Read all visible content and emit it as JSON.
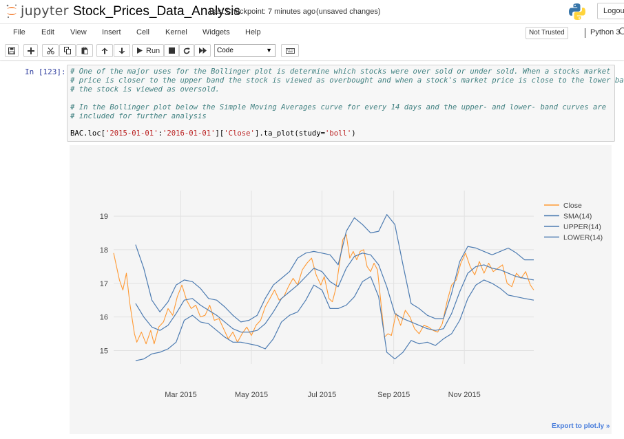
{
  "header": {
    "logo_text": "jupyter",
    "notebook_title": "Stock_Prices_Data_Analysis",
    "checkpoint": "Last Checkpoint: 7 minutes ago",
    "save_status": "(unsaved changes)",
    "logout_label": "Logout"
  },
  "menubar": {
    "items": [
      "File",
      "Edit",
      "View",
      "Insert",
      "Cell",
      "Kernel",
      "Widgets",
      "Help"
    ],
    "trust_label": "Not Trusted",
    "kernel_name": "Python 3"
  },
  "toolbar": {
    "run_label": "Run",
    "cell_type": "Code",
    "icons": [
      "save-icon",
      "plus-icon",
      "cut-icon",
      "copy-icon",
      "paste-icon",
      "arrow-up-icon",
      "arrow-down-icon",
      "run-icon",
      "stop-icon",
      "restart-icon",
      "fast-forward-icon",
      "keyboard-icon"
    ]
  },
  "cell": {
    "prompt": "In [123]:",
    "comment_lines": [
      "# One of the major uses for the Bollinger plot is determine which stocks were over sold or under sold. When a stocks market",
      "# price is closer to the upper band the stock is viewed as overbought and when a stock's market price is close to the lower band",
      "# the stock is viewed as oversold.",
      "",
      "# In the Bollinger plot below the Simple Moving Averages curve for every 14 days and the upper- and lower- band curves are",
      "# included for further analysis"
    ],
    "code": {
      "prefix": "BAC.loc[",
      "arg1": "'2015-01-01'",
      "colon": ":",
      "arg2": "'2016-01-01'",
      "mid": "][",
      "arg3": "'Close'",
      "call": "].ta_plot(study=",
      "arg4": "'boll'",
      "suffix": ")"
    }
  },
  "output": {
    "export_label": "Export to plot.ly »"
  },
  "chart_data": {
    "type": "line",
    "title": "",
    "xlabel": "",
    "ylabel": "",
    "x_tick_labels": [
      "Mar 2015",
      "May 2015",
      "Jul 2015",
      "Sep 2015",
      "Nov 2015"
    ],
    "x_tick_dates": [
      "2015-03-01",
      "2015-05-01",
      "2015-07-01",
      "2015-09-01",
      "2015-11-01"
    ],
    "xlim": [
      "2015-01-02",
      "2015-12-31"
    ],
    "y_ticks": [
      15,
      16,
      17,
      18,
      19
    ],
    "ylim": [
      14.6,
      19.35
    ],
    "grid": true,
    "legend_position": "top-right",
    "series": [
      {
        "name": "Close",
        "color": "#ff9933",
        "points": [
          [
            "2015-01-02",
            17.9
          ],
          [
            "2015-01-07",
            17.1
          ],
          [
            "2015-01-10",
            16.8
          ],
          [
            "2015-01-13",
            17.3
          ],
          [
            "2015-01-16",
            16.4
          ],
          [
            "2015-01-20",
            15.5
          ],
          [
            "2015-01-22",
            15.25
          ],
          [
            "2015-01-26",
            15.55
          ],
          [
            "2015-01-30",
            15.2
          ],
          [
            "2015-02-03",
            15.6
          ],
          [
            "2015-02-06",
            15.2
          ],
          [
            "2015-02-10",
            15.7
          ],
          [
            "2015-02-14",
            15.85
          ],
          [
            "2015-02-18",
            16.25
          ],
          [
            "2015-02-22",
            16.05
          ],
          [
            "2015-02-26",
            16.6
          ],
          [
            "2015-03-02",
            16.95
          ],
          [
            "2015-03-06",
            16.5
          ],
          [
            "2015-03-10",
            16.25
          ],
          [
            "2015-03-14",
            16.35
          ],
          [
            "2015-03-18",
            16.0
          ],
          [
            "2015-03-22",
            16.05
          ],
          [
            "2015-03-26",
            16.35
          ],
          [
            "2015-03-30",
            15.9
          ],
          [
            "2015-04-03",
            15.95
          ],
          [
            "2015-04-07",
            15.65
          ],
          [
            "2015-04-11",
            15.35
          ],
          [
            "2015-04-15",
            15.55
          ],
          [
            "2015-04-19",
            15.25
          ],
          [
            "2015-04-23",
            15.5
          ],
          [
            "2015-04-27",
            15.7
          ],
          [
            "2015-05-01",
            15.45
          ],
          [
            "2015-05-05",
            15.75
          ],
          [
            "2015-05-09",
            15.9
          ],
          [
            "2015-05-13",
            16.3
          ],
          [
            "2015-05-17",
            16.55
          ],
          [
            "2015-05-21",
            16.8
          ],
          [
            "2015-05-25",
            16.5
          ],
          [
            "2015-05-29",
            16.6
          ],
          [
            "2015-06-02",
            16.9
          ],
          [
            "2015-06-06",
            17.15
          ],
          [
            "2015-06-10",
            16.95
          ],
          [
            "2015-06-14",
            17.4
          ],
          [
            "2015-06-18",
            17.6
          ],
          [
            "2015-06-22",
            17.75
          ],
          [
            "2015-06-26",
            17.25
          ],
          [
            "2015-06-30",
            16.95
          ],
          [
            "2015-07-03",
            17.2
          ],
          [
            "2015-07-07",
            16.55
          ],
          [
            "2015-07-10",
            16.45
          ],
          [
            "2015-07-13",
            16.85
          ],
          [
            "2015-07-16",
            17.55
          ],
          [
            "2015-07-19",
            18.3
          ],
          [
            "2015-07-22",
            18.45
          ],
          [
            "2015-07-25",
            17.75
          ],
          [
            "2015-07-28",
            17.95
          ],
          [
            "2015-07-31",
            17.7
          ],
          [
            "2015-08-03",
            17.95
          ],
          [
            "2015-08-06",
            18.0
          ],
          [
            "2015-08-09",
            17.5
          ],
          [
            "2015-08-12",
            17.35
          ],
          [
            "2015-08-15",
            17.6
          ],
          [
            "2015-08-18",
            17.4
          ],
          [
            "2015-08-21",
            16.4
          ],
          [
            "2015-08-24",
            15.4
          ],
          [
            "2015-08-27",
            15.5
          ],
          [
            "2015-08-30",
            15.45
          ],
          [
            "2015-09-03",
            16.1
          ],
          [
            "2015-09-07",
            15.75
          ],
          [
            "2015-09-11",
            16.2
          ],
          [
            "2015-09-15",
            16.0
          ],
          [
            "2015-09-19",
            15.65
          ],
          [
            "2015-09-23",
            15.5
          ],
          [
            "2015-09-27",
            15.75
          ],
          [
            "2015-10-01",
            15.7
          ],
          [
            "2015-10-05",
            15.6
          ],
          [
            "2015-10-09",
            15.55
          ],
          [
            "2015-10-13",
            15.8
          ],
          [
            "2015-10-17",
            16.45
          ],
          [
            "2015-10-21",
            16.95
          ],
          [
            "2015-10-25",
            17.1
          ],
          [
            "2015-10-29",
            17.6
          ],
          [
            "2015-11-02",
            17.9
          ],
          [
            "2015-11-06",
            17.5
          ],
          [
            "2015-11-10",
            17.25
          ],
          [
            "2015-11-14",
            17.65
          ],
          [
            "2015-11-18",
            17.3
          ],
          [
            "2015-11-22",
            17.6
          ],
          [
            "2015-11-26",
            17.35
          ],
          [
            "2015-11-30",
            17.45
          ],
          [
            "2015-12-04",
            17.55
          ],
          [
            "2015-12-08",
            17.0
          ],
          [
            "2015-12-12",
            16.9
          ],
          [
            "2015-12-16",
            17.3
          ],
          [
            "2015-12-20",
            17.15
          ],
          [
            "2015-12-24",
            17.35
          ],
          [
            "2015-12-28",
            16.95
          ],
          [
            "2015-12-31",
            16.8
          ]
        ]
      },
      {
        "name": "SMA(14)",
        "color": "#4c7bb1",
        "points": [
          [
            "2015-01-21",
            16.4
          ],
          [
            "2015-01-28",
            16.0
          ],
          [
            "2015-02-04",
            15.7
          ],
          [
            "2015-02-11",
            15.6
          ],
          [
            "2015-02-18",
            15.75
          ],
          [
            "2015-02-25",
            16.1
          ],
          [
            "2015-03-04",
            16.5
          ],
          [
            "2015-03-11",
            16.55
          ],
          [
            "2015-03-18",
            16.35
          ],
          [
            "2015-03-25",
            16.2
          ],
          [
            "2015-04-01",
            16.05
          ],
          [
            "2015-04-08",
            15.85
          ],
          [
            "2015-04-15",
            15.65
          ],
          [
            "2015-04-22",
            15.55
          ],
          [
            "2015-04-29",
            15.55
          ],
          [
            "2015-05-06",
            15.6
          ],
          [
            "2015-05-13",
            15.8
          ],
          [
            "2015-05-20",
            16.15
          ],
          [
            "2015-05-27",
            16.55
          ],
          [
            "2015-06-03",
            16.75
          ],
          [
            "2015-06-10",
            16.95
          ],
          [
            "2015-06-17",
            17.2
          ],
          [
            "2015-06-24",
            17.45
          ],
          [
            "2015-07-01",
            17.35
          ],
          [
            "2015-07-08",
            17.05
          ],
          [
            "2015-07-15",
            16.9
          ],
          [
            "2015-07-22",
            17.45
          ],
          [
            "2015-07-29",
            17.8
          ],
          [
            "2015-08-05",
            17.9
          ],
          [
            "2015-08-12",
            17.85
          ],
          [
            "2015-08-19",
            17.55
          ],
          [
            "2015-08-26",
            16.9
          ],
          [
            "2015-09-02",
            16.1
          ],
          [
            "2015-09-09",
            15.95
          ],
          [
            "2015-09-16",
            15.85
          ],
          [
            "2015-09-23",
            15.75
          ],
          [
            "2015-09-30",
            15.65
          ],
          [
            "2015-10-07",
            15.6
          ],
          [
            "2015-10-14",
            15.65
          ],
          [
            "2015-10-21",
            16.1
          ],
          [
            "2015-10-28",
            16.75
          ],
          [
            "2015-11-04",
            17.3
          ],
          [
            "2015-11-11",
            17.5
          ],
          [
            "2015-11-18",
            17.55
          ],
          [
            "2015-11-25",
            17.45
          ],
          [
            "2015-12-02",
            17.4
          ],
          [
            "2015-12-09",
            17.3
          ],
          [
            "2015-12-16",
            17.2
          ],
          [
            "2015-12-23",
            17.15
          ],
          [
            "2015-12-31",
            17.1
          ]
        ]
      },
      {
        "name": "UPPER(14)",
        "color": "#4c7bb1",
        "points": [
          [
            "2015-01-21",
            18.15
          ],
          [
            "2015-01-28",
            17.45
          ],
          [
            "2015-02-04",
            16.5
          ],
          [
            "2015-02-11",
            16.15
          ],
          [
            "2015-02-18",
            16.45
          ],
          [
            "2015-02-25",
            16.95
          ],
          [
            "2015-03-04",
            17.1
          ],
          [
            "2015-03-11",
            17.05
          ],
          [
            "2015-03-18",
            16.85
          ],
          [
            "2015-03-25",
            16.55
          ],
          [
            "2015-04-01",
            16.5
          ],
          [
            "2015-04-08",
            16.3
          ],
          [
            "2015-04-15",
            16.05
          ],
          [
            "2015-04-22",
            15.85
          ],
          [
            "2015-04-29",
            15.9
          ],
          [
            "2015-05-06",
            16.05
          ],
          [
            "2015-05-13",
            16.55
          ],
          [
            "2015-05-20",
            16.95
          ],
          [
            "2015-05-27",
            17.15
          ],
          [
            "2015-06-03",
            17.35
          ],
          [
            "2015-06-10",
            17.75
          ],
          [
            "2015-06-17",
            17.9
          ],
          [
            "2015-06-24",
            17.95
          ],
          [
            "2015-07-01",
            17.9
          ],
          [
            "2015-07-08",
            17.85
          ],
          [
            "2015-07-15",
            17.55
          ],
          [
            "2015-07-22",
            18.55
          ],
          [
            "2015-07-29",
            18.95
          ],
          [
            "2015-08-05",
            18.75
          ],
          [
            "2015-08-12",
            18.5
          ],
          [
            "2015-08-19",
            18.55
          ],
          [
            "2015-08-26",
            19.05
          ],
          [
            "2015-09-02",
            18.75
          ],
          [
            "2015-09-09",
            17.55
          ],
          [
            "2015-09-16",
            16.4
          ],
          [
            "2015-09-23",
            16.25
          ],
          [
            "2015-09-30",
            16.05
          ],
          [
            "2015-10-07",
            15.95
          ],
          [
            "2015-10-14",
            15.95
          ],
          [
            "2015-10-21",
            16.7
          ],
          [
            "2015-10-28",
            17.65
          ],
          [
            "2015-11-04",
            18.1
          ],
          [
            "2015-11-11",
            18.05
          ],
          [
            "2015-11-18",
            17.95
          ],
          [
            "2015-11-25",
            17.85
          ],
          [
            "2015-12-02",
            17.95
          ],
          [
            "2015-12-09",
            18.05
          ],
          [
            "2015-12-16",
            17.9
          ],
          [
            "2015-12-23",
            17.7
          ],
          [
            "2015-12-31",
            17.7
          ]
        ]
      },
      {
        "name": "LOWER(14)",
        "color": "#4c7bb1",
        "points": [
          [
            "2015-01-21",
            14.7
          ],
          [
            "2015-01-28",
            14.75
          ],
          [
            "2015-02-04",
            14.9
          ],
          [
            "2015-02-11",
            14.95
          ],
          [
            "2015-02-18",
            15.05
          ],
          [
            "2015-02-25",
            15.25
          ],
          [
            "2015-03-04",
            15.9
          ],
          [
            "2015-03-11",
            16.05
          ],
          [
            "2015-03-18",
            15.85
          ],
          [
            "2015-03-25",
            15.8
          ],
          [
            "2015-04-01",
            15.6
          ],
          [
            "2015-04-08",
            15.4
          ],
          [
            "2015-04-15",
            15.25
          ],
          [
            "2015-04-22",
            15.25
          ],
          [
            "2015-04-29",
            15.2
          ],
          [
            "2015-05-06",
            15.15
          ],
          [
            "2015-05-13",
            15.05
          ],
          [
            "2015-05-20",
            15.35
          ],
          [
            "2015-05-27",
            15.85
          ],
          [
            "2015-06-03",
            16.05
          ],
          [
            "2015-06-10",
            16.15
          ],
          [
            "2015-06-17",
            16.5
          ],
          [
            "2015-06-24",
            16.95
          ],
          [
            "2015-07-01",
            16.8
          ],
          [
            "2015-07-08",
            16.25
          ],
          [
            "2015-07-15",
            16.25
          ],
          [
            "2015-07-22",
            16.35
          ],
          [
            "2015-07-29",
            16.6
          ],
          [
            "2015-08-05",
            17.05
          ],
          [
            "2015-08-12",
            17.2
          ],
          [
            "2015-08-19",
            16.6
          ],
          [
            "2015-08-26",
            14.95
          ],
          [
            "2015-09-02",
            14.75
          ],
          [
            "2015-09-09",
            14.95
          ],
          [
            "2015-09-16",
            15.3
          ],
          [
            "2015-09-23",
            15.2
          ],
          [
            "2015-09-30",
            15.25
          ],
          [
            "2015-10-07",
            15.15
          ],
          [
            "2015-10-14",
            15.35
          ],
          [
            "2015-10-21",
            15.5
          ],
          [
            "2015-10-28",
            15.9
          ],
          [
            "2015-11-04",
            16.55
          ],
          [
            "2015-11-11",
            16.95
          ],
          [
            "2015-11-18",
            17.1
          ],
          [
            "2015-11-25",
            17.0
          ],
          [
            "2015-12-02",
            16.85
          ],
          [
            "2015-12-09",
            16.65
          ],
          [
            "2015-12-16",
            16.6
          ],
          [
            "2015-12-23",
            16.55
          ],
          [
            "2015-12-31",
            16.5
          ]
        ]
      }
    ]
  }
}
